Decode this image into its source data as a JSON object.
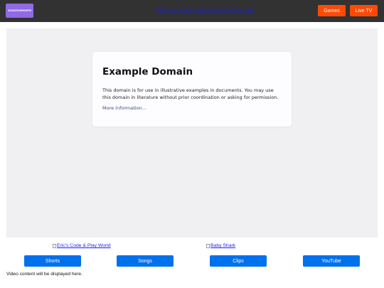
{
  "header": {
    "logo_text": "SCRATCHMONTH",
    "promo_link": "GET NEW SCRATCHMONTH VIDEO ONLINE",
    "games_label": "Games",
    "live_tv_label": "Live TV"
  },
  "embedded_page": {
    "title": "Example Domain",
    "body": "This domain is for use in illustrative examples in documents. You may use this domain in literature without prior coordination or asking for permission.",
    "link": "More information..."
  },
  "image_links": [
    {
      "alt": "Eric's Code & Play World"
    },
    {
      "alt": "Baby Shark"
    }
  ],
  "nav_buttons": [
    "Shorts",
    "Songs",
    "Clips",
    "YouTube"
  ],
  "status_text": "Video content will be displayed here.",
  "colors": {
    "topbar": "#323232",
    "logo": "#8f69e6",
    "header_button": "#ff4a05",
    "nav_button": "#0071ec",
    "link": "#1a1aff"
  }
}
